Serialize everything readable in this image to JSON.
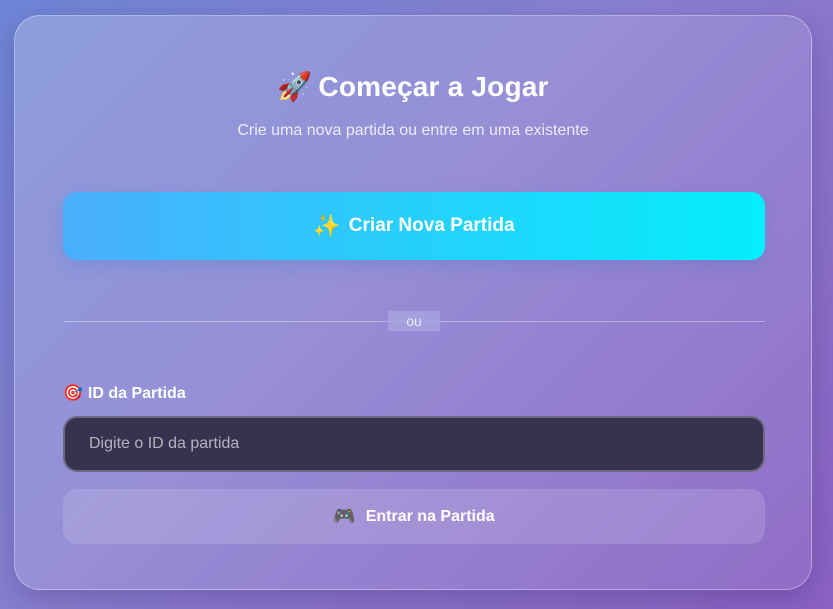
{
  "header": {
    "icon": "rocket-icon",
    "icon_glyph": "🚀",
    "title": "Começar a Jogar",
    "subtitle": "Crie uma nova partida ou entre em uma existente"
  },
  "create": {
    "icon": "sparkles-icon",
    "icon_glyph": "✨",
    "label": "Criar Nova Partida"
  },
  "divider": {
    "text": "ou"
  },
  "join": {
    "field_icon": "target-icon",
    "field_icon_glyph": "🎯",
    "field_label": "ID da Partida",
    "input_value": "",
    "input_placeholder": "Digite o ID da partida",
    "button_icon": "gamepad-icon",
    "button_icon_glyph": "🎮",
    "button_label": "Entrar na Partida"
  },
  "colors": {
    "create_button_start": "#4aaefc",
    "create_button_end": "#05eefd",
    "input_background": "#37324f",
    "background_start": "#6f86d6",
    "background_end": "#8b62c4"
  }
}
